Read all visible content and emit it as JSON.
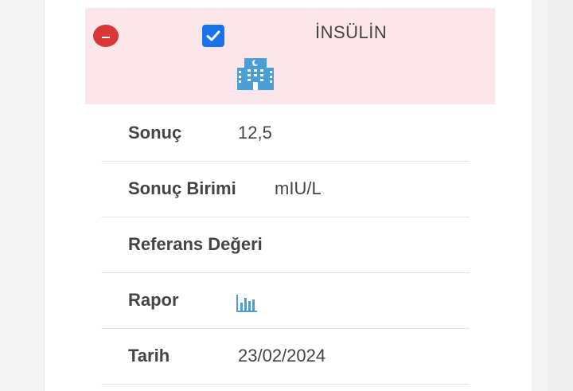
{
  "test": {
    "title": "İNSÜLİN",
    "checked": true,
    "status_icon": "hospital-icon",
    "remove_icon": "minus-circle-icon"
  },
  "rows": [
    {
      "label": "Sonuç",
      "value": "12,5"
    },
    {
      "label": "Sonuç Birimi",
      "value": "mIU/L"
    },
    {
      "label": "Referans Değeri",
      "value": ""
    },
    {
      "label": "Rapor",
      "icon": "bar-chart-icon"
    },
    {
      "label": "Tarih",
      "value": "23/02/2024"
    }
  ],
  "colors": {
    "header_bg": "#fde6e9",
    "remove_red": "#d83838",
    "checkbox_blue": "#1a73e8",
    "icon_blue": "#4a9fd8"
  }
}
